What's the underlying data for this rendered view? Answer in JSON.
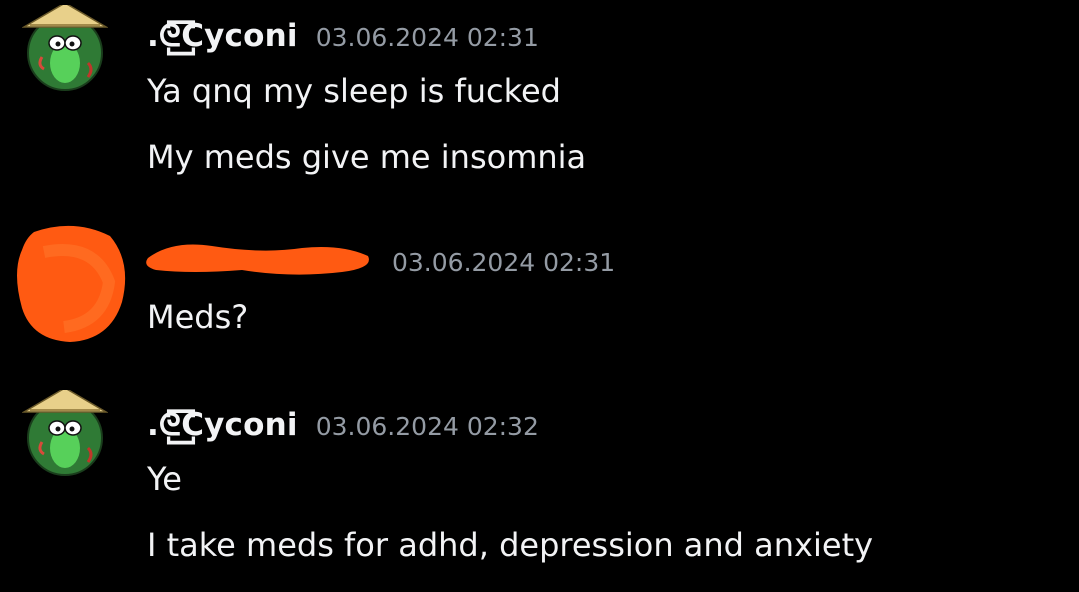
{
  "messages": [
    {
      "author": ".ᘓ꙱Cyconi",
      "timestamp": "03.06.2024 02:31",
      "lines": [
        "Ya qnq my sleep is fucked",
        "My meds give me insomnia"
      ]
    },
    {
      "author": "",
      "timestamp": "03.06.2024 02:31",
      "lines": [
        "Meds?"
      ]
    },
    {
      "author": ".ᘓ꙱Cyconi",
      "timestamp": "03.06.2024 02:32",
      "lines": [
        "Ye",
        "I take meds for adhd, depression and anxiety"
      ]
    }
  ],
  "colors": {
    "background": "#000000",
    "text": "#f2f3f5",
    "timestamp": "#949ba4",
    "redaction": "#ff5a12",
    "avatar_green": "#3a8a3a"
  },
  "icons": {
    "avatar": "frog-with-straw-hat-avatar",
    "redacted_avatar": "redacted-avatar-scribble",
    "redacted_name": "redacted-username-scribble"
  }
}
